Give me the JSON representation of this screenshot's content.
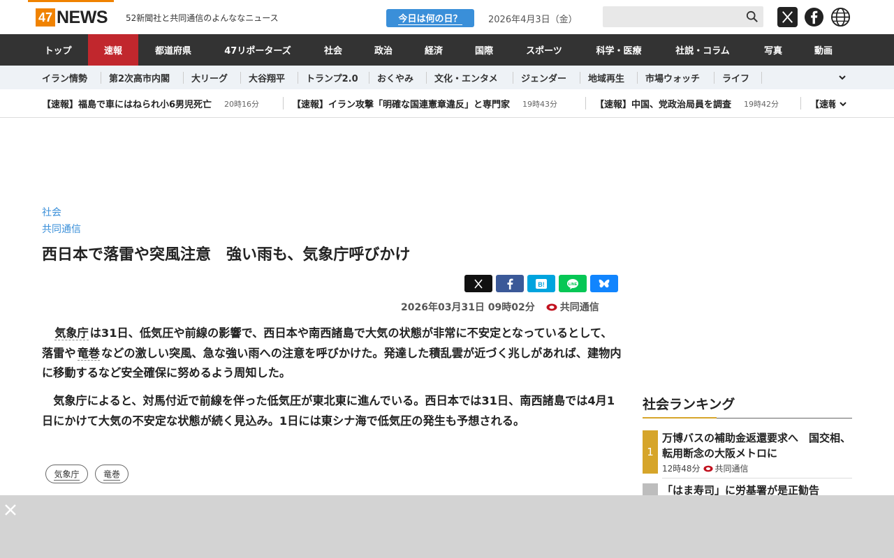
{
  "header": {
    "logo_num": "47",
    "logo_word": "NEWS",
    "tagline": "52新聞社と共同通信のよんななニュース",
    "today_button": "今日は何の日？",
    "date": "2026年4月3日（金）",
    "search_placeholder": ""
  },
  "nav": {
    "items": [
      "トップ",
      "速報",
      "都道府県",
      "47リポーターズ",
      "社会",
      "政治",
      "経済",
      "国際",
      "スポーツ",
      "科学・医療",
      "社説・コラム",
      "写真",
      "動画"
    ],
    "active": "速報"
  },
  "subnav": {
    "items": [
      "イラン情勢",
      "第2次高市内閣",
      "大リーグ",
      "大谷翔平",
      "トランプ2.0",
      "おくやみ",
      "文化・エンタメ",
      "ジェンダー",
      "地域再生",
      "市場ウォッチ",
      "ライフ"
    ]
  },
  "ticker": {
    "items": [
      {
        "text": "【速報】福島で車にはねられ小6男児死亡",
        "time": "20時16分"
      },
      {
        "text": "【速報】イラン攻撃「明確な国連憲章違反」と専門家",
        "time": "19時43分"
      },
      {
        "text": "【速報】中国、党政治局員を調査",
        "time": "19時42分"
      },
      {
        "text": "【速報",
        "time": ""
      }
    ]
  },
  "article": {
    "category": "社会",
    "source_link": "共同通信",
    "title": "西日本で落雷や突風注意　強い雨も、気象庁呼びかけ",
    "datetime": "2026年03月31日 09時02分",
    "source": "共同通信",
    "p1_kw1": "気象庁",
    "p1_a": "は31日、低気圧や前線の影響で、西日本や南西諸島で大気の状態が非常に不安定となっているとして、落雷や",
    "p1_kw2": "竜巻",
    "p1_b": "などの激しい突風、急な強い雨への注意を呼びかけた。発達した積乱雲が近づく兆しがあれば、建物内に移動するなど安全確保に努めるよう周知した。",
    "p2": "気象庁によると、対馬付近で前線を伴った低気圧が東北東に進んでいる。西日本では31日、南西諸島では4月1日にかけて大気の不安定な状態が続く見込み。1日には東シナ海で低気圧の発生も予想される。",
    "tags": [
      "気象庁",
      "竜巻"
    ]
  },
  "ranking": {
    "title": "社会ランキング",
    "items": [
      {
        "rank": "1",
        "text": "万博バスの補助金返還要求へ　国交相、転用断念の大阪メトロに",
        "time": "12時48分",
        "source": "共同通信",
        "color": "#d6a52a"
      },
      {
        "rank": "2",
        "text": "「はま寿司」に労基署が是正勧告",
        "color": "#bdbdbd"
      }
    ]
  },
  "colors": {
    "accent": "#f08200",
    "nav_active": "#c1272d",
    "link": "#3a8fd9"
  }
}
